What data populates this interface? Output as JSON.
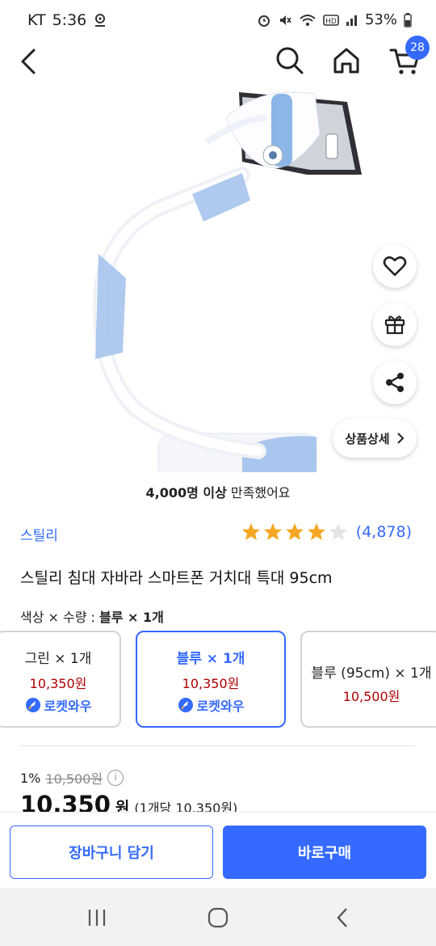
{
  "status_bar": {
    "carrier": "KT",
    "time": "5:36",
    "battery": "53%",
    "icons": [
      "location-icon",
      "alarm-icon",
      "mute-icon",
      "wifi-icon",
      "hd-icon",
      "signal-icon",
      "battery-icon"
    ]
  },
  "header": {
    "cart_count": "28",
    "icons": [
      "back-icon",
      "search-icon",
      "home-icon",
      "cart-icon"
    ]
  },
  "side_actions": {
    "icons": [
      "heart-icon",
      "gift-icon",
      "share-icon"
    ],
    "detail_label": "상품상세"
  },
  "satisfaction": {
    "bold": "4,000명 이상",
    "rest": " 만족했어요"
  },
  "product": {
    "brand": "스틸리",
    "rating": 4.5,
    "review_count": "(4,878)",
    "title": "스틸리 침대 자바라 스마트폰 거치대 특대 95cm"
  },
  "options": {
    "label_prefix": "색상 × 수량 : ",
    "label_selected": "블루 × 1개",
    "items": [
      {
        "name": "그린 × 1개",
        "price": "10,350원",
        "badge": "로켓와우",
        "selected": false
      },
      {
        "name": "블루 × 1개",
        "price": "10,350원",
        "badge": "로켓와우",
        "selected": true
      },
      {
        "name": "블루 (95cm) × 1개",
        "price": "10,500원",
        "selected": false
      }
    ]
  },
  "pricing": {
    "discount_rate": "1%",
    "original_price": "10,500원",
    "final_price": "10,350",
    "currency": "원",
    "unit_price": "(1개당 10,350원)"
  },
  "actions": {
    "add_to_cart": "장바구니 담기",
    "buy_now": "바로구매"
  },
  "colors": {
    "accent": "#346aff",
    "price_red": "#ae0000",
    "star": "#f5a623"
  }
}
